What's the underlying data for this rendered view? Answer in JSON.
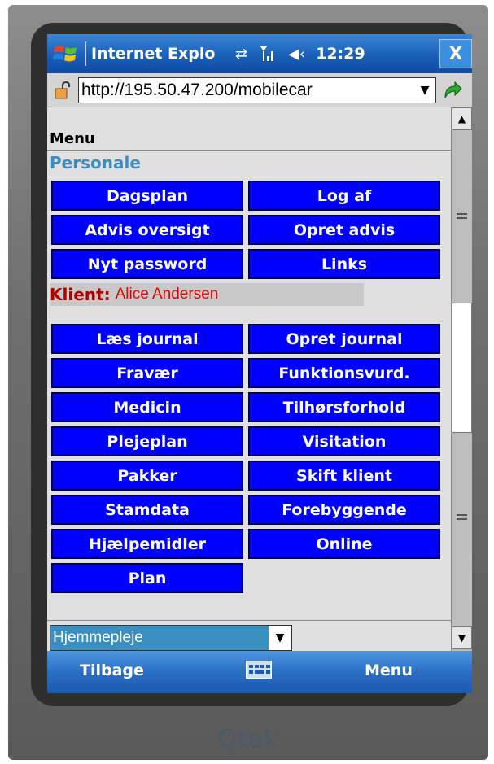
{
  "titlebar": {
    "app_title": "Internet Explo",
    "clock": "12:29",
    "close_label": "X"
  },
  "addressbar": {
    "url": "http://195.50.47.200/mobilecar"
  },
  "content": {
    "menu_heading": "Menu",
    "personale_heading": "Personale",
    "personale_buttons": [
      "Dagsplan",
      "Log af",
      "Advis oversigt",
      "Opret advis",
      "Nyt password",
      "Links"
    ],
    "klient_label": "Klient:",
    "klient_name": "Alice Andersen",
    "klient_buttons": [
      "Læs journal",
      "Opret journal",
      "Fravær",
      "Funktionsvurd.",
      "Medicin",
      "Tilhørsforhold",
      "Plejeplan",
      "Visitation",
      "Pakker",
      "Skift klient",
      "Stamdata",
      "Forebyggende",
      "Hjælpemidler",
      "Online",
      "Plan"
    ],
    "select_value": "Hjemmepleje"
  },
  "softkeys": {
    "left": "Tilbage",
    "right": "Menu"
  },
  "device": {
    "brand": "Qtek"
  },
  "colors": {
    "button_blue": "#0000ff",
    "titlebar_blue": "#1a5fb8",
    "klient_red": "#e00000",
    "heading_blue": "#3b8ec0"
  }
}
